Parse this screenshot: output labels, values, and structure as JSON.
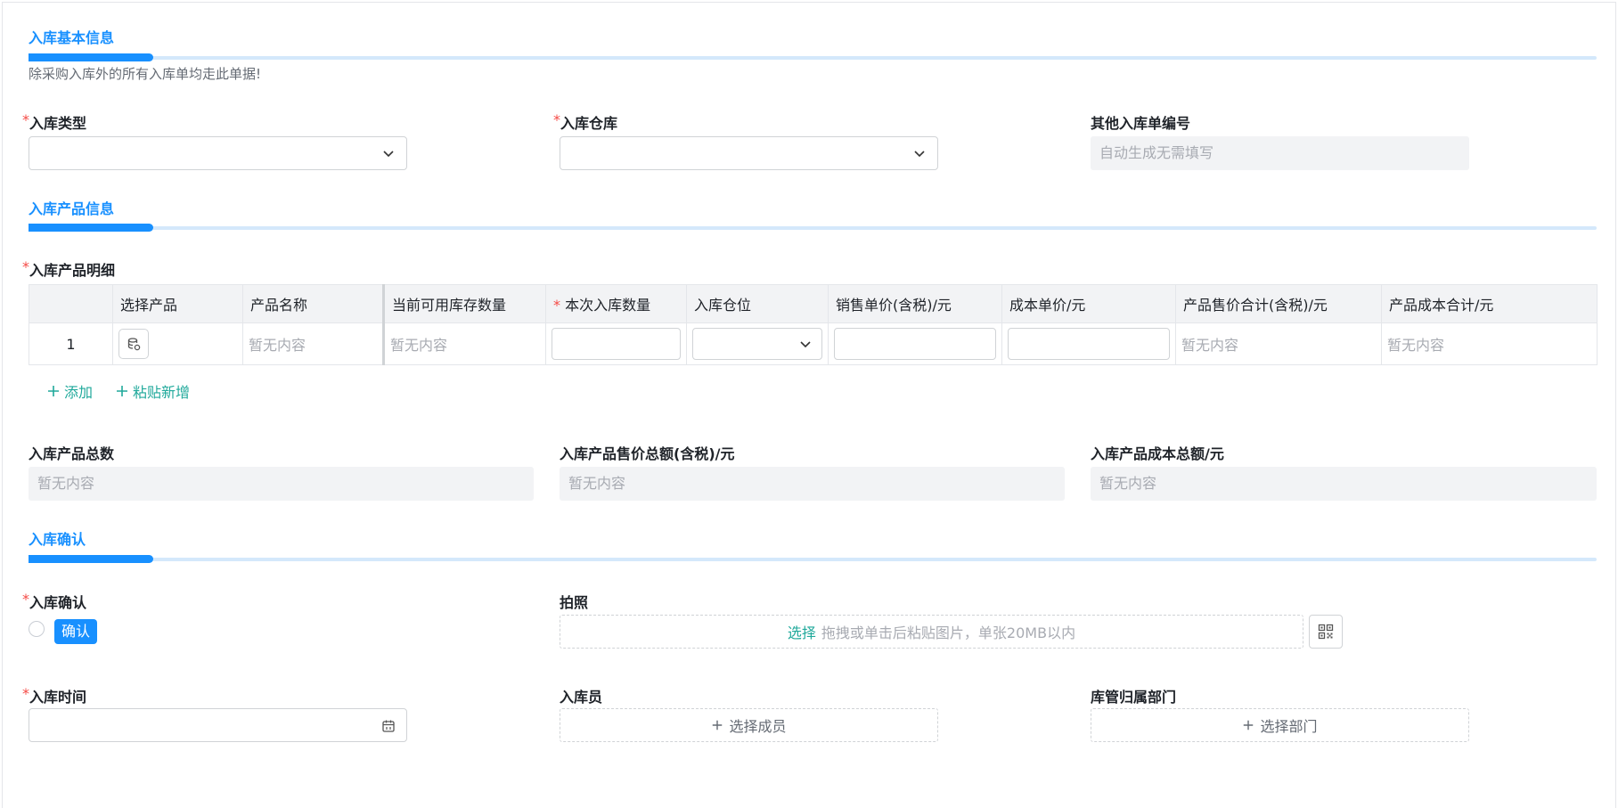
{
  "basic": {
    "title": "入库基本信息",
    "desc": "除采购入库外的所有入库单均走此单据!",
    "req_mark": "*",
    "type_label": "入库类型",
    "warehouse_label": "入库仓库",
    "number_label": "其他入库单编号",
    "number_placeholder": "自动生成无需填写"
  },
  "product": {
    "title": "入库产品信息",
    "detail_label": "入库产品明细",
    "columns": [
      "选择产品",
      "产品名称",
      "当前可用库存数量",
      "本次入库数量",
      "入库仓位",
      "销售单价(含税)/元",
      "成本单价/元",
      "产品售价合计(含税)/元",
      "产品成本合计/元"
    ],
    "rows": [
      {
        "index": "1",
        "name": "暂无内容",
        "stock": "暂无内容",
        "sale_total": "暂无内容",
        "cost_total": "暂无内容"
      }
    ],
    "add_label": "添加",
    "paste_label": "粘贴新增",
    "total_count_label": "入库产品总数",
    "total_sale_label": "入库产品售价总额(含税)/元",
    "total_cost_label": "入库产品成本总额/元",
    "empty": "暂无内容"
  },
  "confirm": {
    "title": "入库确认",
    "confirm_label": "入库确认",
    "confirm_tag": "确认",
    "photo_label": "拍照",
    "photo_select": "选择",
    "photo_hint": "拖拽或单击后粘贴图片，单张20MB以内",
    "time_label": "入库时间",
    "staff_label": "入库员",
    "staff_btn": "选择成员",
    "dept_label": "库管归属部门",
    "dept_btn": "选择部门"
  },
  "colors": {
    "accent": "#1890ff",
    "link": "#20a99b",
    "required": "#f54a45"
  }
}
